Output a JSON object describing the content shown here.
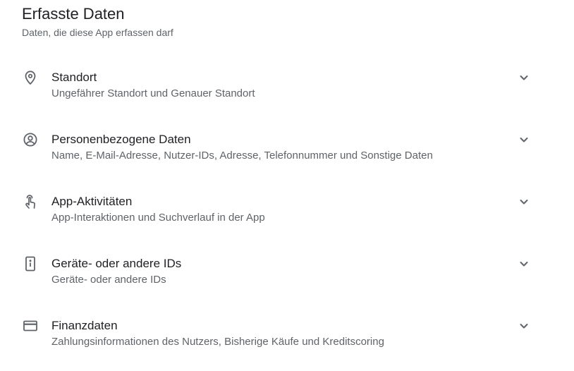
{
  "header": {
    "title": "Erfasste Daten",
    "subtitle": "Daten, die diese App erfassen darf"
  },
  "items": [
    {
      "icon": "location-pin-icon",
      "title": "Standort",
      "description": "Ungefährer Standort und Genauer Standort"
    },
    {
      "icon": "account-circle-icon",
      "title": "Personenbezogene Daten",
      "description": "Name, E-Mail-Adresse, Nutzer-IDs, Adresse, Telefonnummer und Sonstige Daten"
    },
    {
      "icon": "touch-app-icon",
      "title": "App-Aktivitäten",
      "description": "App-Interaktionen und Suchverlauf in der App"
    },
    {
      "icon": "device-info-icon",
      "title": "Geräte- oder andere IDs",
      "description": "Geräte- oder andere IDs"
    },
    {
      "icon": "credit-card-icon",
      "title": "Finanzdaten",
      "description": "Zahlungsinformationen des Nutzers, Bisherige Käufe und Kreditscoring"
    }
  ],
  "colors": {
    "text_primary": "#202124",
    "text_secondary": "#5f6368",
    "icon": "#5f6368"
  }
}
